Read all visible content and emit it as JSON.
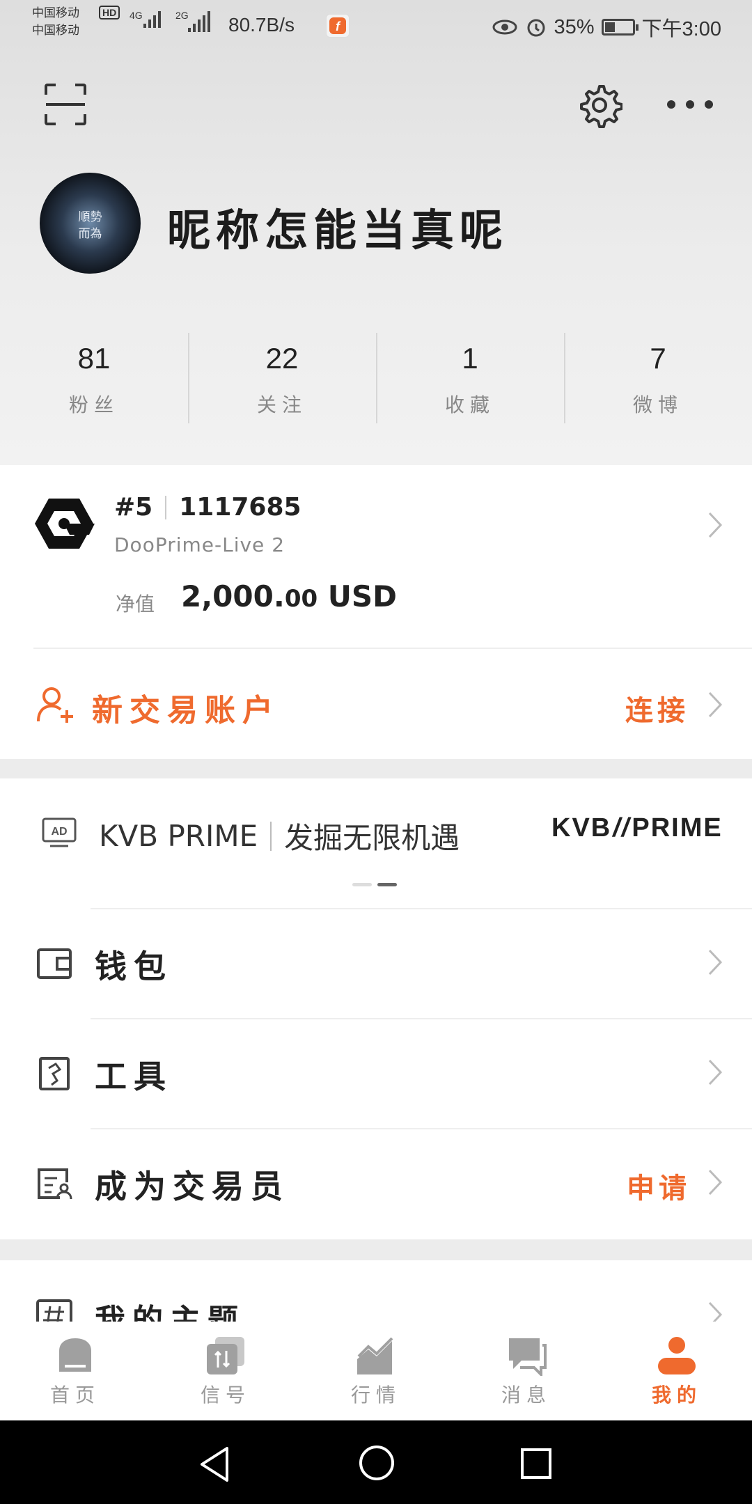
{
  "status_bar": {
    "carrier1": "中国移动",
    "carrier2": "中国移动",
    "hd": "HD",
    "net1": "4G",
    "net2": "2G",
    "speed": "80.7B/s",
    "battery": "35%",
    "time": "下午3:00",
    "icons": [
      "eye-icon",
      "alarm-icon",
      "battery-icon"
    ]
  },
  "header": {
    "scan_icon": "scan-icon",
    "settings_icon": "gear-icon",
    "more_icon": "more-icon"
  },
  "profile": {
    "avatar_text_line1": "順勢",
    "avatar_text_line2": "而為",
    "nickname": "昵称怎能当真呢",
    "stats": [
      {
        "value": "81",
        "label": "粉丝"
      },
      {
        "value": "22",
        "label": "关注"
      },
      {
        "value": "1",
        "label": "收藏"
      },
      {
        "value": "7",
        "label": "微博"
      }
    ]
  },
  "account": {
    "rank": "#5",
    "number": "1117685",
    "server": "DooPrime-Live 2",
    "equity_label": "净值",
    "equity_main": "2,000.",
    "equity_cents": "00",
    "equity_currency": " USD",
    "new_account_label": "新交易账户",
    "connect_label": "连接"
  },
  "banner": {
    "ad_title": "KVB PRIME",
    "ad_subtitle": "发掘无限机遇",
    "brand_left": "KVB",
    "brand_right": "PRIME",
    "page_count": 2,
    "active_page": 2
  },
  "menu": [
    {
      "label": "钱包",
      "icon": "wallet-icon",
      "action": ""
    },
    {
      "label": "工具",
      "icon": "tools-icon",
      "action": ""
    },
    {
      "label": "成为交易员",
      "icon": "trader-icon",
      "action": "申请"
    },
    {
      "label": "我的主题",
      "icon": "hashtag-icon",
      "action": ""
    }
  ],
  "tabs": [
    {
      "label": "首页",
      "icon": "home-icon",
      "active": false
    },
    {
      "label": "信号",
      "icon": "signal-icon",
      "active": false
    },
    {
      "label": "行情",
      "icon": "market-icon",
      "active": false
    },
    {
      "label": "消息",
      "icon": "message-icon",
      "active": false
    },
    {
      "label": "我的",
      "icon": "profile-icon",
      "active": true
    }
  ],
  "colors": {
    "accent": "#ef6a2e",
    "text": "#222222",
    "muted": "#888888"
  }
}
